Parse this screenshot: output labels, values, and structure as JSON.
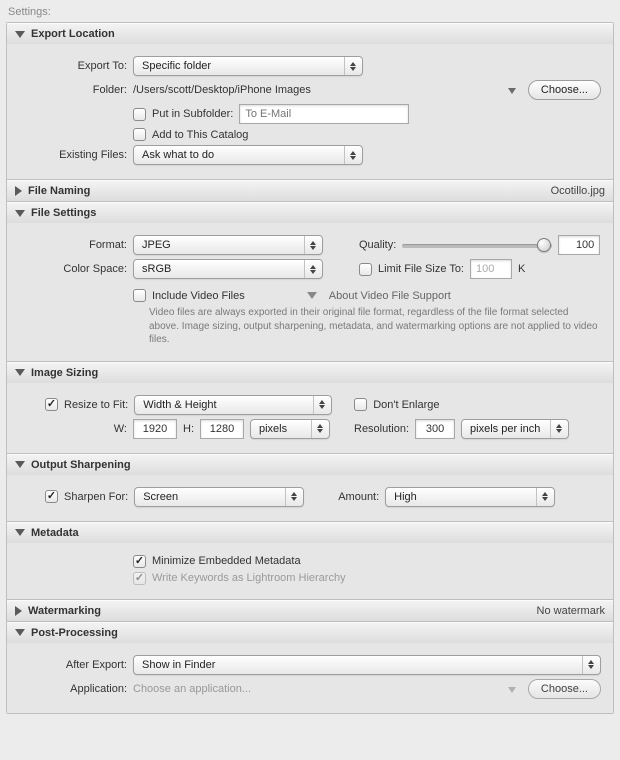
{
  "settings_label": "Settings:",
  "sections": {
    "export_location": {
      "title": "Export Location",
      "export_to_label": "Export To:",
      "export_to_value": "Specific folder",
      "folder_label": "Folder:",
      "folder_path": "/Users/scott/Desktop/iPhone Images",
      "choose_btn": "Choose...",
      "subfolder_label": "Put in Subfolder:",
      "subfolder_placeholder": "To E-Mail",
      "add_to_catalog_label": "Add to This Catalog",
      "existing_files_label": "Existing Files:",
      "existing_files_value": "Ask what to do"
    },
    "file_naming": {
      "title": "File Naming",
      "aux": "Ocotillo.jpg"
    },
    "file_settings": {
      "title": "File Settings",
      "format_label": "Format:",
      "format_value": "JPEG",
      "quality_label": "Quality:",
      "quality_value": "100",
      "color_space_label": "Color Space:",
      "color_space_value": "sRGB",
      "limit_label": "Limit File Size To:",
      "limit_value": "100",
      "limit_unit": "K",
      "include_video_label": "Include Video Files",
      "about_video_label": "About Video File Support",
      "video_hint": "Video files are always exported in their original file format, regardless of the file format selected above. Image sizing, output sharpening, metadata, and watermarking options are not applied to video files."
    },
    "image_sizing": {
      "title": "Image Sizing",
      "resize_label": "Resize to Fit:",
      "resize_value": "Width & Height",
      "dont_enlarge_label": "Don't Enlarge",
      "w_label": "W:",
      "w_value": "1920",
      "h_label": "H:",
      "h_value": "1280",
      "unit_value": "pixels",
      "resolution_label": "Resolution:",
      "resolution_value": "300",
      "resolution_unit": "pixels per inch"
    },
    "output_sharpening": {
      "title": "Output Sharpening",
      "sharpen_label": "Sharpen For:",
      "sharpen_value": "Screen",
      "amount_label": "Amount:",
      "amount_value": "High"
    },
    "metadata": {
      "title": "Metadata",
      "minimize_label": "Minimize Embedded Metadata",
      "keywords_label": "Write Keywords as Lightroom Hierarchy"
    },
    "watermarking": {
      "title": "Watermarking",
      "aux": "No watermark"
    },
    "post_processing": {
      "title": "Post-Processing",
      "after_export_label": "After Export:",
      "after_export_value": "Show in Finder",
      "application_label": "Application:",
      "application_placeholder": "Choose an application...",
      "choose_btn": "Choose..."
    }
  }
}
